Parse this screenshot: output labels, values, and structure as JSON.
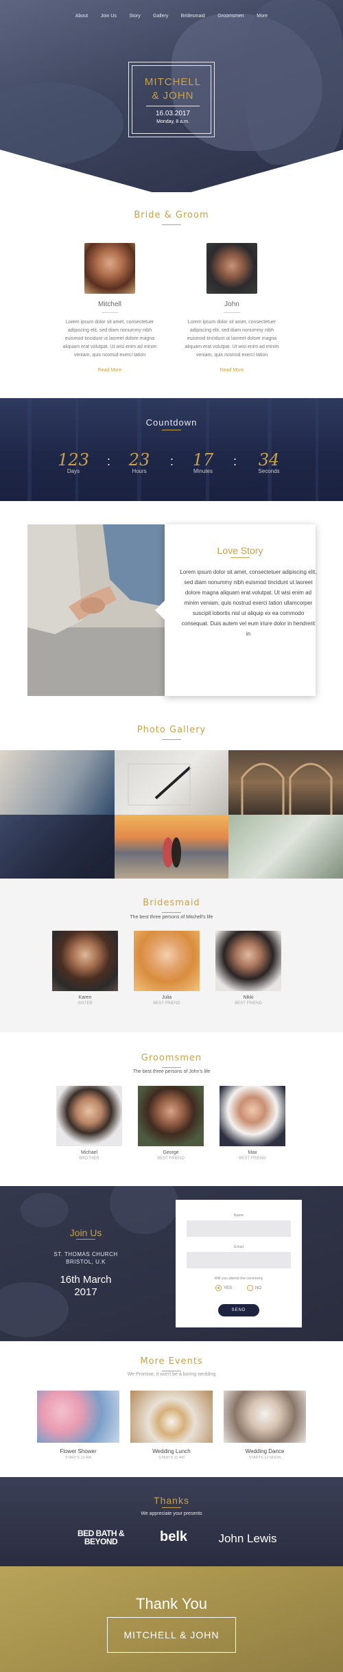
{
  "nav": {
    "items": [
      "About",
      "Join Us",
      "Story",
      "Gallery",
      "Bridesmaid",
      "Groomsmen",
      "More"
    ]
  },
  "hero": {
    "names_line1": "MITCHELL",
    "names_line2": "& JOHN",
    "date": "16.03.2017",
    "time": "Monday, 8 a.m."
  },
  "couple": {
    "title": "Bride & Groom",
    "bride": {
      "name": "Mitchell",
      "text": "Lorem ipsum dolor sit amet, consectetuer adipiscing elit, sed diam nonummy nibh euismod tincidunt ut laoreet dolore magna aliquam erat volutpat. Ut wisi enim ad minim veniam, quis nostrud exerci tation",
      "link": "Read More"
    },
    "groom": {
      "name": "John",
      "text": "Lorem ipsum dolor sit amet, consectetuer adipiscing elit, sed diam nonummy nibh euismod tincidunt ut laoreet dolore magna aliquam erat volutpat. Ut wisi enim ad minim veniam, quis nostrud exerci tation",
      "link": "Read More"
    }
  },
  "countdown": {
    "title": "Countdown",
    "items": [
      {
        "value": "123",
        "label": "Days"
      },
      {
        "value": "23",
        "label": "Hours"
      },
      {
        "value": "17",
        "label": "Minutes"
      },
      {
        "value": "34",
        "label": "Seconds"
      }
    ],
    "separator": ":"
  },
  "story": {
    "title": "Love Story",
    "text": "Lorem ipsum dolor sit amet, consectetuer adipiscing elit, sed diam nonummy nibh euismod tincidunt ut laoreet dolore magna aliquam erat volutpat. Ut wisi enim ad minim veniam, quis nostrud exerci tation ullamcorper suscipit lobortis nisl ut aliquip ex ea commodo consequat. Duis autem vel eum iriure dolor in hendrerit in"
  },
  "gallery": {
    "title": "Photo Gallery"
  },
  "bridesmaid": {
    "title": "Bridesmaid",
    "subtitle": "The best three persons of Mitchell's life",
    "members": [
      {
        "name": "Karen",
        "role": "SISTER"
      },
      {
        "name": "Julia",
        "role": "BEST FRIEND"
      },
      {
        "name": "Nikki",
        "role": "BEST FRIEND"
      }
    ]
  },
  "groomsmen": {
    "title": "Groomsmen",
    "subtitle": "The best three persons of John's life",
    "members": [
      {
        "name": "Michael",
        "role": "BROTHER"
      },
      {
        "name": "George",
        "role": "BEST FRIEND"
      },
      {
        "name": "Max",
        "role": "BEST FRIEND"
      }
    ]
  },
  "join": {
    "title": "Join Us",
    "church_line1": "ST. THOMAS CHURCH",
    "church_line2": "BRISTOL, U.K",
    "date_line1": "16th March",
    "date_line2": "2017",
    "form": {
      "name_label": "Name",
      "email_label": "Email",
      "attend_label": "Will you attend the ceremony",
      "yes": "YES",
      "no": "NO",
      "send": "SEND"
    }
  },
  "events": {
    "title": "More Events",
    "subtitle": "We Promise, it won't be a boring wedding",
    "items": [
      {
        "name": "Flower Shower",
        "time": "STARTS 10 AM"
      },
      {
        "name": "Wedding Lunch",
        "time": "STARTS 11 AM"
      },
      {
        "name": "Wedding Dance",
        "time": "STARTS 12 NOON"
      }
    ]
  },
  "thanks": {
    "title": "Thanks",
    "subtitle": "We appreciate your presents",
    "brand1_line1": "BED BATH &",
    "brand1_line2": "BEYOND",
    "brand2": "belk",
    "brand3": "John Lewis"
  },
  "final": {
    "title": "Thank You",
    "names": "MITCHELL & JOHN"
  },
  "colors": {
    "accent": "#c9a14a",
    "dark_navy": "#1e2440"
  }
}
